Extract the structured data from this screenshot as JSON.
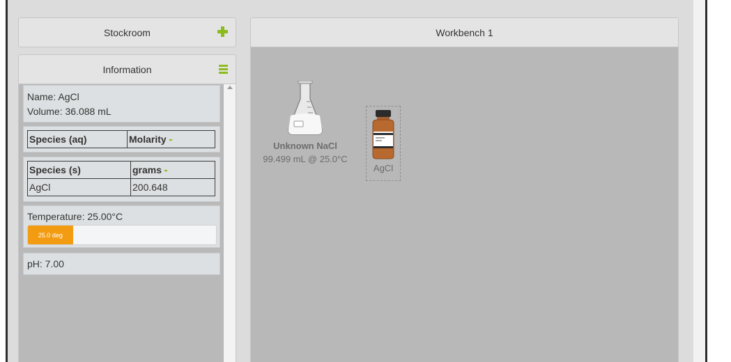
{
  "stockroom": {
    "title": "Stockroom",
    "action_icon": "plus-icon"
  },
  "information": {
    "title": "Information",
    "menu_icon": "menu-icon",
    "name_line": "Name: AgCl",
    "volume_line": "Volume: 36.088 mL",
    "aqueous_table": {
      "headers": [
        "Species (aq)",
        "Molarity"
      ],
      "rows": []
    },
    "solid_table": {
      "headers": [
        "Species (s)",
        "grams"
      ],
      "rows": [
        {
          "species": "AgCl",
          "amount": "200.648"
        }
      ]
    },
    "temperature_label": "Temperature: 25.00°C",
    "temperature_bar": {
      "text": "25.0 deg",
      "fill_fraction": 0.24,
      "color": "#f39c12"
    },
    "ph_label": "pH: 7.00"
  },
  "workbench": {
    "title": "Workbench 1",
    "items": [
      {
        "name": "Unknown NaCl",
        "detail": "99.499 mL @ 25.0°C",
        "icon": "erlenmeyer-flask-icon"
      },
      {
        "name": "AgCl",
        "icon": "reagent-bottle-icon"
      }
    ]
  },
  "colors": {
    "accent": "#8dbb1d",
    "temperature": "#f39c12",
    "workbench_bg": "#b8b8b8"
  }
}
